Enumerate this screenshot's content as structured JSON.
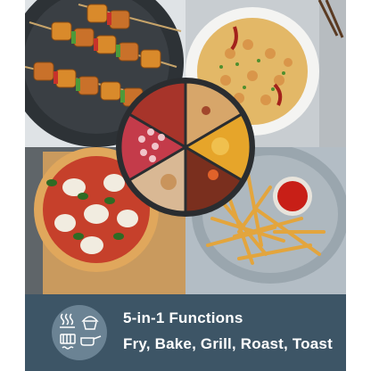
{
  "banner": {
    "headline": "5-in-1 Functions",
    "subline": "Fry, Bake, Grill, Roast, Toast",
    "background": "#3d5566",
    "badge_color": "#6b8394"
  },
  "icons": [
    "steam-icon",
    "muffin-icon",
    "grill-icon",
    "pan-icon"
  ],
  "photos": [
    "grilled-paneer-skewers",
    "fried-rice-with-shrimp",
    "margherita-pizza",
    "french-fries-with-ketchup"
  ]
}
